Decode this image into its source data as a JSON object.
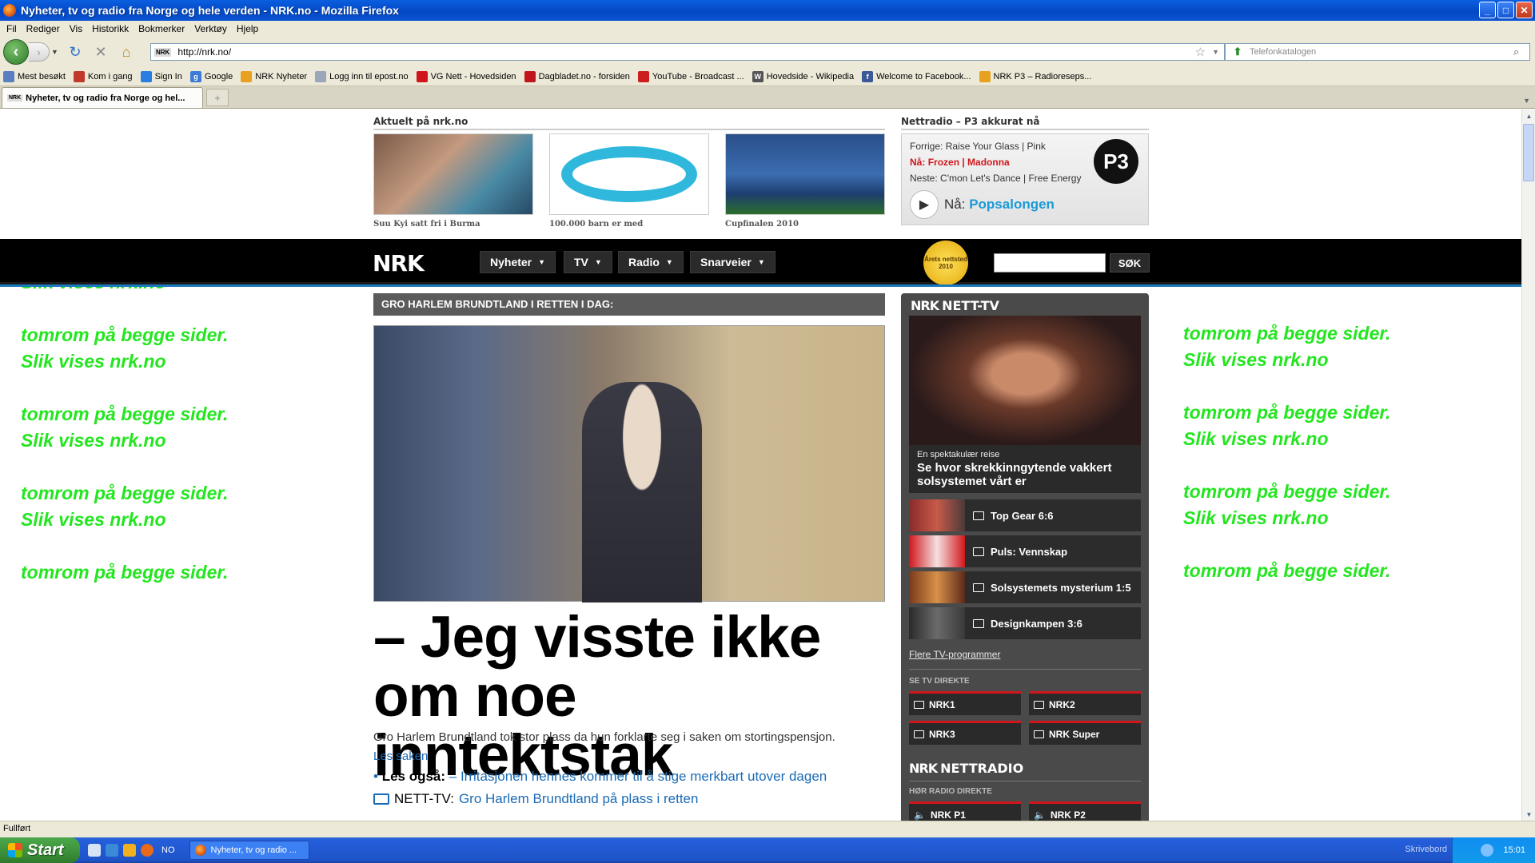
{
  "window": {
    "title": "Nyheter, tv og radio fra Norge og hele verden - NRK.no - Mozilla Firefox",
    "controls": [
      "_",
      "□",
      "✕"
    ]
  },
  "menubar": [
    "Fil",
    "Rediger",
    "Vis",
    "Historikk",
    "Bokmerker",
    "Verktøy",
    "Hjelp"
  ],
  "navbar": {
    "url": "http://nrk.no/",
    "url_favicon": "NRK",
    "search_placeholder": "Telefonkatalogen"
  },
  "bookmarks": [
    {
      "label": "Mest besøkt",
      "icon": "bookmark-icon",
      "color": "#5a7fc0"
    },
    {
      "label": "Kom i gang",
      "icon": "firefox-icon",
      "color": "#c0392b"
    },
    {
      "label": "Sign In",
      "icon": "windows-icon",
      "color": "#2a7de1"
    },
    {
      "label": "Google",
      "icon": "google-icon",
      "color": "#3c7bd8"
    },
    {
      "label": "NRK Nyheter",
      "icon": "feed-icon",
      "color": "#e8a020"
    },
    {
      "label": "Logg inn til epost.no",
      "icon": "page-icon",
      "color": "#9aa7b8"
    },
    {
      "label": "VG Nett - Hovedsiden",
      "icon": "vg-icon",
      "color": "#d0161b"
    },
    {
      "label": "Dagbladet.no - forsiden",
      "icon": "db-icon",
      "color": "#c0161b"
    },
    {
      "label": "YouTube - Broadcast ...",
      "icon": "youtube-icon",
      "color": "#cc1e1e"
    },
    {
      "label": "Hovedside - Wikipedia",
      "icon": "wikipedia-icon",
      "color": "#555555"
    },
    {
      "label": "Welcome to Facebook...",
      "icon": "facebook-icon",
      "color": "#3b5998"
    },
    {
      "label": "NRK P3 – Radioreseps...",
      "icon": "feed-icon",
      "color": "#e8a020"
    }
  ],
  "tab": {
    "favicon": "NRK",
    "label": "Nyheter, tv og radio fra Norge og hel...",
    "new_tab": "+"
  },
  "side_text": {
    "line_a": "Slik vises nrk.no",
    "line_b": "tomrom på begge sider."
  },
  "top": {
    "aktuelt_head": "Aktuelt på nrk.no",
    "thumbs": [
      {
        "caption": "Suu Kyi satt fri i Burma"
      },
      {
        "caption": "100.000 barn er med"
      },
      {
        "caption": "Cupfinalen 2010"
      }
    ],
    "radio_head": "Nettradio – P3 akkurat nå",
    "radio": {
      "forrige_label": "Forrige:",
      "forrige": "Raise Your Glass | Pink",
      "na_label": "Nå:",
      "na": "Frozen | Madonna",
      "neste_label": "Neste:",
      "neste": "C'mon Let's Dance | Free Energy",
      "now_label": "Nå:",
      "now_show": "Popsalongen",
      "logo": "P3"
    }
  },
  "nrk_nav": {
    "logo": "NRK",
    "menus": [
      "Nyheter",
      "TV",
      "Radio",
      "Snarveier"
    ],
    "badge": "Årets nettsted 2010",
    "search_button": "SØK"
  },
  "article": {
    "kicker": "GRO HARLEM BRUNDTLAND I RETTEN I DAG:",
    "title_line1": "– Jeg visste ikke",
    "title_line2": "om noe inntektstak",
    "lead": "Gro Harlem Brundtland tok stor plass da hun forklarte seg i saken om stortingspensjon.",
    "read_more": "Les saken",
    "also_label": "Les også:",
    "also_link": "– Irritasjonen hennes kommer til å stige merkbart utover dagen",
    "nett_tv_label": "NETT-TV:",
    "nett_tv_link": "Gro Harlem Brundtland på plass i retten"
  },
  "nett_tv": {
    "head_logo": "NRK",
    "head": "NETT-TV",
    "feature_kicker": "En spektakulær reise",
    "feature_title": "Se hvor skrekkinngytende vakkert solsystemet vårt er",
    "programs": [
      "Top Gear 6:6",
      "Puls: Vennskap",
      "Solsystemets mysterium 1:5",
      "Designkampen 3:6"
    ],
    "more": "Flere TV-programmer",
    "live_head": "SE TV DIREKTE",
    "channels": [
      "NRK1",
      "NRK2",
      "NRK3",
      "NRK Super"
    ],
    "radio_head_logo": "NRK",
    "radio_head": "NETTRADIO",
    "radio_live_head": "HØR RADIO DIREKTE",
    "radio_channels": [
      "NRK P1",
      "NRK P2"
    ]
  },
  "status": "Fullført",
  "taskbar": {
    "start": "Start",
    "lang": "NO",
    "task": "Nyheter, tv og radio ...",
    "desktop": "Skrivebord",
    "clock": "15:01"
  }
}
